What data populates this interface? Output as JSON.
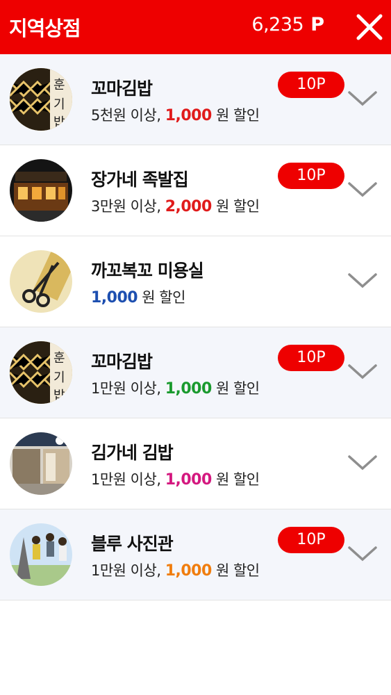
{
  "header": {
    "title": "지역상점",
    "points_value": "6,235",
    "points_unit": "P"
  },
  "stores": [
    {
      "name": "꼬마김밥",
      "condition": "5천원 이상,",
      "amount": "1,000",
      "suffix": "원 할인",
      "amount_color": "#e01b1b",
      "badge": "10P",
      "image": "kimbap-sign"
    },
    {
      "name": "장가네 족발집",
      "condition": "3만원 이상,",
      "amount": "2,000",
      "suffix": "원 할인",
      "amount_color": "#e01b1b",
      "badge": "10P",
      "image": "restaurant-night"
    },
    {
      "name": "까꼬복꼬 미용실",
      "condition": "",
      "amount": "1,000",
      "suffix": "원 할인",
      "amount_color": "#1d4fb0",
      "badge": "",
      "image": "scissors"
    },
    {
      "name": "꼬마김밥",
      "condition": "1만원 이상,",
      "amount": "1,000",
      "suffix": "원 할인",
      "amount_color": "#1a9a2e",
      "badge": "10P",
      "image": "kimbap-sign"
    },
    {
      "name": "김가네 김밥",
      "condition": "1만원 이상,",
      "amount": "1,000",
      "suffix": "원 할인",
      "amount_color": "#d4187f",
      "badge": "",
      "image": "storefront"
    },
    {
      "name": "블루 사진관",
      "condition": "1만원 이상,",
      "amount": "1,000",
      "suffix": "원 할인",
      "amount_color": "#f07d0e",
      "badge": "10P",
      "image": "jumping-people"
    }
  ]
}
